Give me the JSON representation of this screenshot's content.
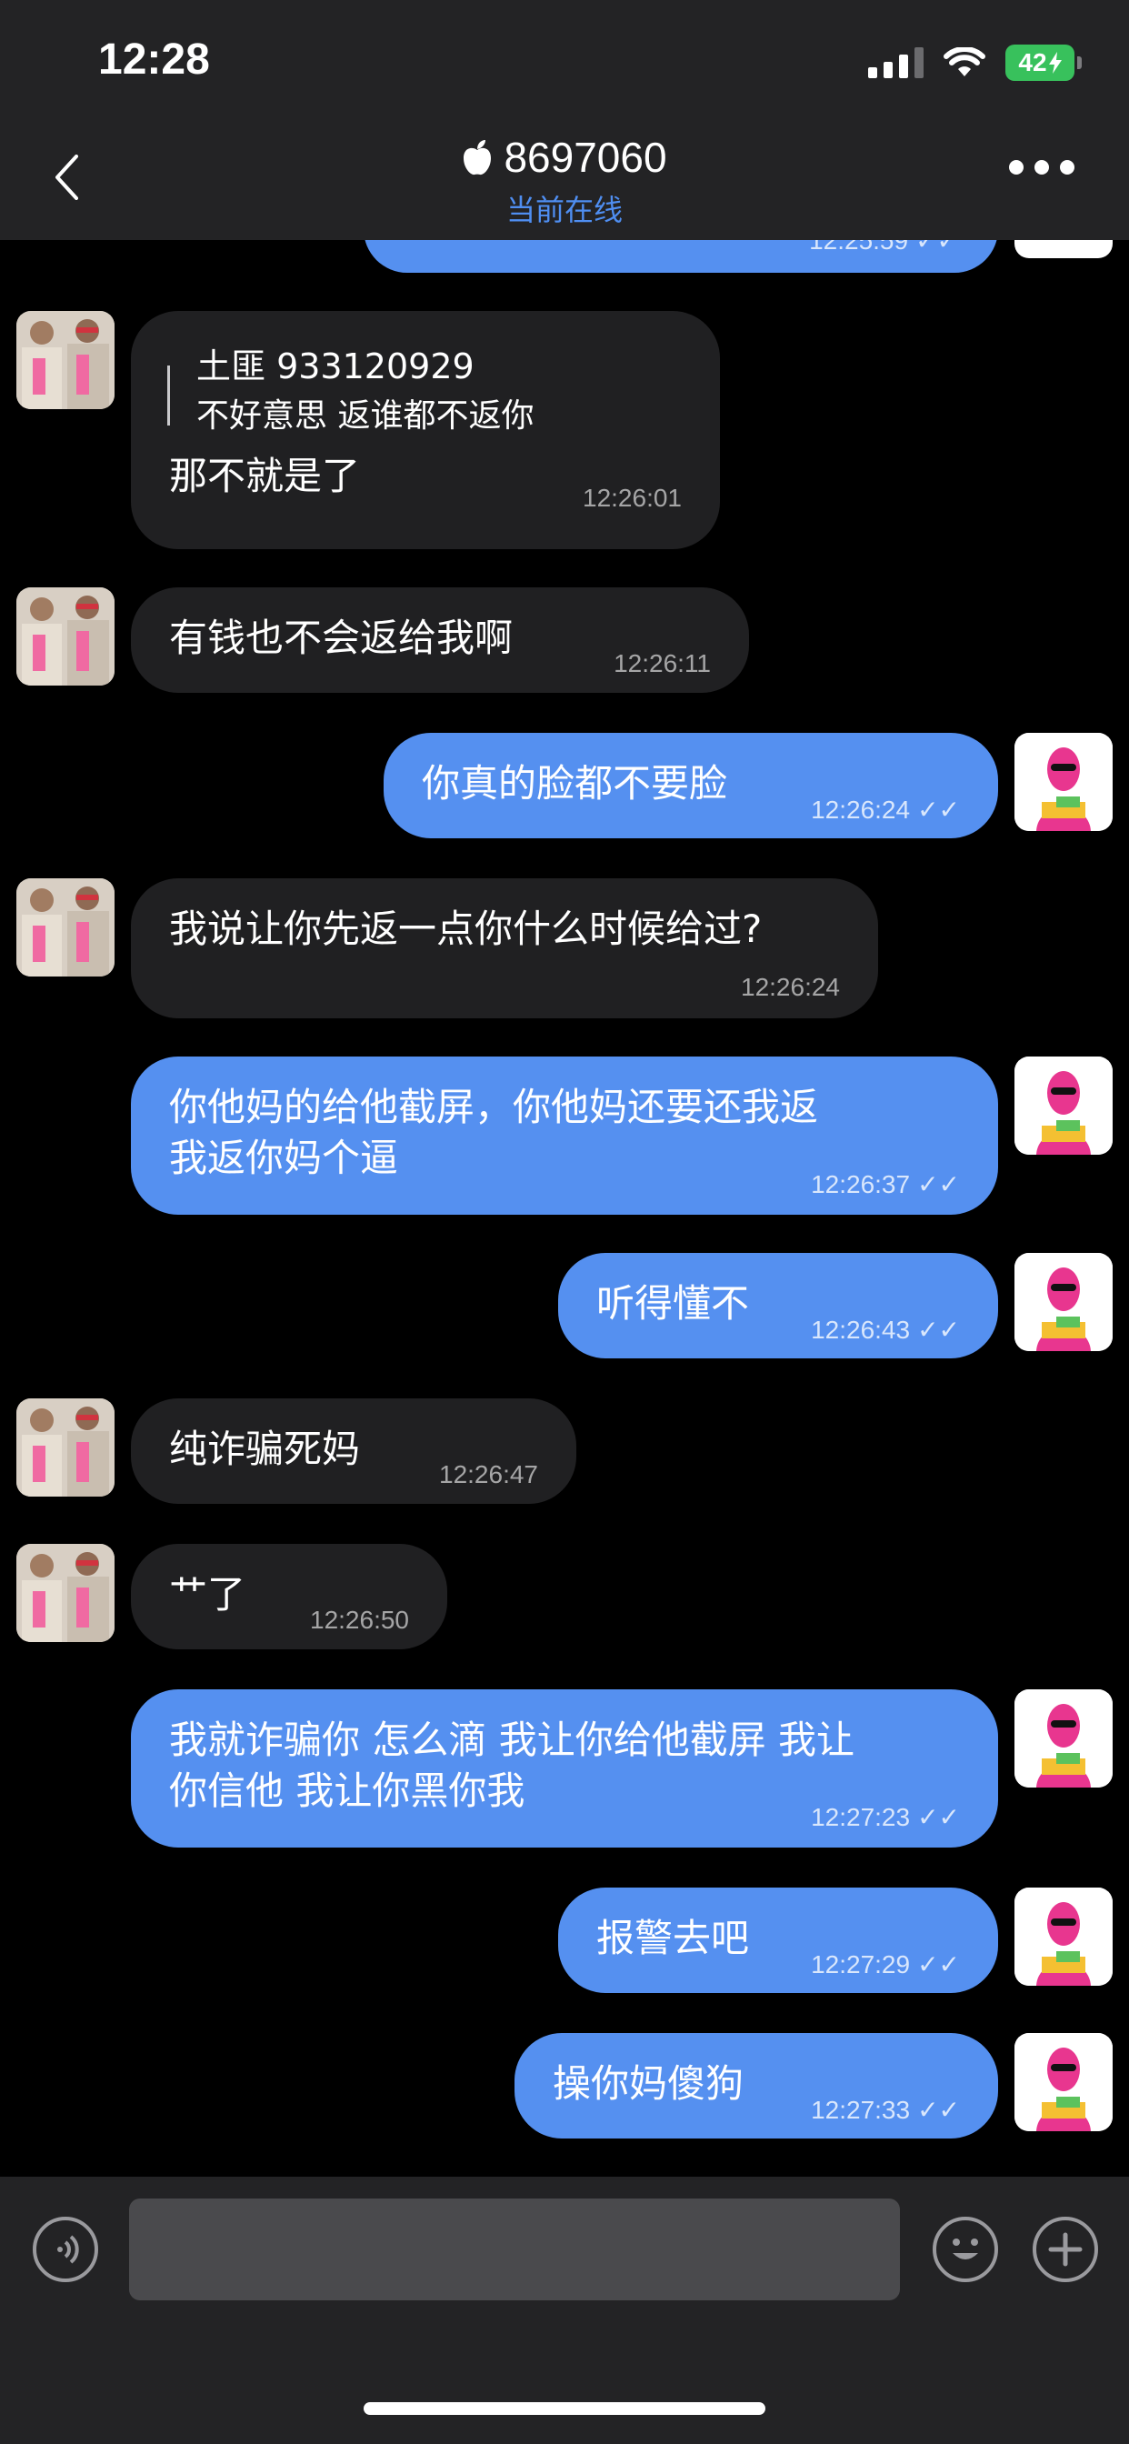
{
  "status_bar": {
    "time": "12:28",
    "battery": "42"
  },
  "header": {
    "title": "8697060",
    "subtitle": "当前在线",
    "title_icon": "apple-icon"
  },
  "messages": [
    {
      "side": "out",
      "time": "12:25:59",
      "partial": true
    },
    {
      "side": "in",
      "quote_name": "土匪 933120929",
      "quote_text": "不好意思 返谁都不返你",
      "text": "那不就是了",
      "time": "12:26:01"
    },
    {
      "side": "in",
      "text": "有钱也不会返给我啊",
      "time": "12:26:11"
    },
    {
      "side": "out",
      "text": "你真的脸都不要脸",
      "time": "12:26:24"
    },
    {
      "side": "in",
      "text": "我说让你先返一点你什么时候给过?",
      "time": "12:26:24"
    },
    {
      "side": "out",
      "line1": "你他妈的给他截屏，你他妈还要还我返",
      "line2": "我返你妈个逼",
      "time": "12:26:37"
    },
    {
      "side": "out",
      "text": "听得懂不",
      "time": "12:26:43"
    },
    {
      "side": "in",
      "text": "纯诈骗死妈",
      "time": "12:26:47"
    },
    {
      "side": "in",
      "text": "艹了",
      "time": "12:26:50"
    },
    {
      "side": "out",
      "line1": "我就诈骗你 怎么滴 我让你给他截屏 我让",
      "line2": "你信他 我让你黑你我",
      "time": "12:27:23"
    },
    {
      "side": "out",
      "text": "报警去吧",
      "time": "12:27:29"
    },
    {
      "side": "out",
      "text": "操你妈傻狗",
      "time": "12:27:33"
    }
  ],
  "input": {
    "placeholder": ""
  },
  "colors": {
    "outgoing_bubble": "#5590f0",
    "incoming_bubble": "#202022",
    "online": "#4f8ef1",
    "battery": "#38c15c"
  }
}
